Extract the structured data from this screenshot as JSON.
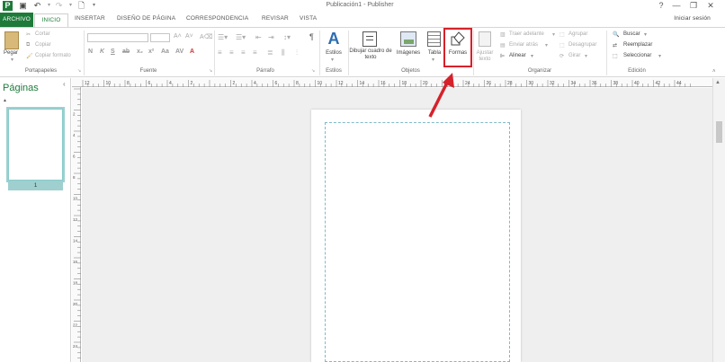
{
  "window": {
    "title": "Publicación1 - Publisher",
    "controls": [
      "?",
      "—",
      "❐",
      "✕"
    ]
  },
  "quick_access": [
    "publisher-logo-icon",
    "save-icon",
    "undo-icon",
    "redo-icon",
    "new-document-icon",
    "customize-icon"
  ],
  "tabs": {
    "archivo": "ARCHIVO",
    "inicio": "INICIO",
    "insertar": "INSERTAR",
    "diseno": "DISEÑO DE PÁGINA",
    "correspondencia": "CORRESPONDENCIA",
    "revisar": "REVISAR",
    "vista": "VISTA"
  },
  "signin": "Iniciar sesión",
  "ribbon": {
    "portapapeles": {
      "label": "Portapapeles",
      "pegar": "Pegar",
      "cortar": "Cortar",
      "copiar": "Copiar",
      "copiar_formato": "Copiar formato"
    },
    "fuente": {
      "label": "Fuente",
      "bold": "N",
      "italic": "K",
      "underline": "S"
    },
    "parrafo": {
      "label": "Párrafo"
    },
    "estilos": {
      "label": "Estilos",
      "button": "Estilos"
    },
    "objetos": {
      "label": "Objetos",
      "dibujar": "Dibujar cuadro de texto",
      "imagenes": "Imágenes",
      "tabla": "Tabla",
      "formas": "Formas"
    },
    "organizar": {
      "label": "Organizar",
      "ajustar": "Ajustar texto",
      "traer": "Traer adelante",
      "enviar": "Enviar atrás",
      "alinear": "Alinear",
      "agrupar": "Agrupar",
      "desagrupar": "Desagrupar",
      "girar": "Girar"
    },
    "edicion": {
      "label": "Edición",
      "buscar": "Buscar",
      "reemplazar": "Reemplazar",
      "seleccionar": "Seleccionar"
    }
  },
  "pages_pane": {
    "title": "Páginas",
    "page_number": "1"
  },
  "ruler_labels": [
    "12",
    "10",
    "8",
    "6",
    "4",
    "2",
    "",
    "2",
    "4",
    "6",
    "8",
    "10",
    "12",
    "14",
    "16",
    "18",
    "20",
    "22",
    "24",
    "26",
    "28",
    "30",
    "32",
    "34",
    "36",
    "38",
    "40",
    "42",
    "44"
  ],
  "vruler_labels": [
    "",
    "2",
    "4",
    "6",
    "8",
    "10",
    "12",
    "14",
    "16",
    "18",
    "20",
    "22",
    "24"
  ],
  "colors": {
    "accent": "#1e7b3a",
    "highlight": "#d6212b",
    "guide": "#7fb9c9"
  }
}
